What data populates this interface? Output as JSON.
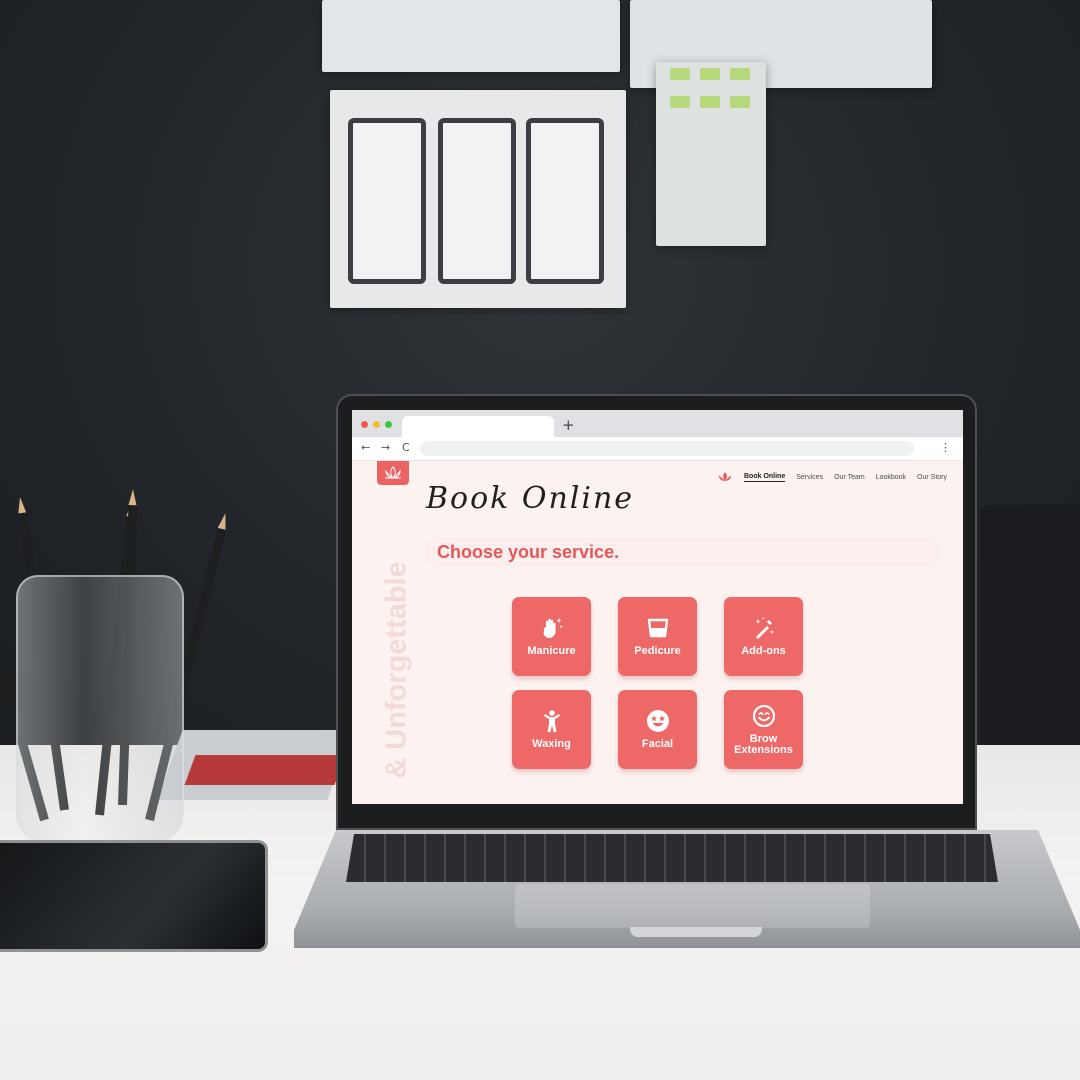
{
  "browser": {
    "new_tab_glyph": "+",
    "back_glyph": "←",
    "forward_glyph": "→",
    "reload_glyph": "C",
    "menu_glyph": "⋮"
  },
  "site": {
    "logo_icon": "lotus-icon",
    "nav": {
      "icon": "lotus-icon",
      "items": [
        {
          "label": "Book Online",
          "active": true
        },
        {
          "label": "Services",
          "active": false
        },
        {
          "label": "Our Team",
          "active": false
        },
        {
          "label": "Lookbook",
          "active": false
        },
        {
          "label": "Our Story",
          "active": false
        }
      ]
    },
    "side_text": "& Unforgettable",
    "page_title": "Book Online",
    "prompt": "Choose your service.",
    "services": [
      {
        "label": "Manicure",
        "icon": "hand-sparkle-icon"
      },
      {
        "label": "Pedicure",
        "icon": "foot-bath-icon"
      },
      {
        "label": "Add-ons",
        "icon": "magic-wand-icon"
      },
      {
        "label": "Waxing",
        "icon": "person-icon"
      },
      {
        "label": "Facial",
        "icon": "star-eyes-face-icon"
      },
      {
        "label": "Brow Extensions",
        "icon": "smiling-face-icon"
      }
    ],
    "colors": {
      "accent": "#ee6868",
      "background": "#fcf3f1",
      "prompt_text": "#df5a5a"
    }
  }
}
